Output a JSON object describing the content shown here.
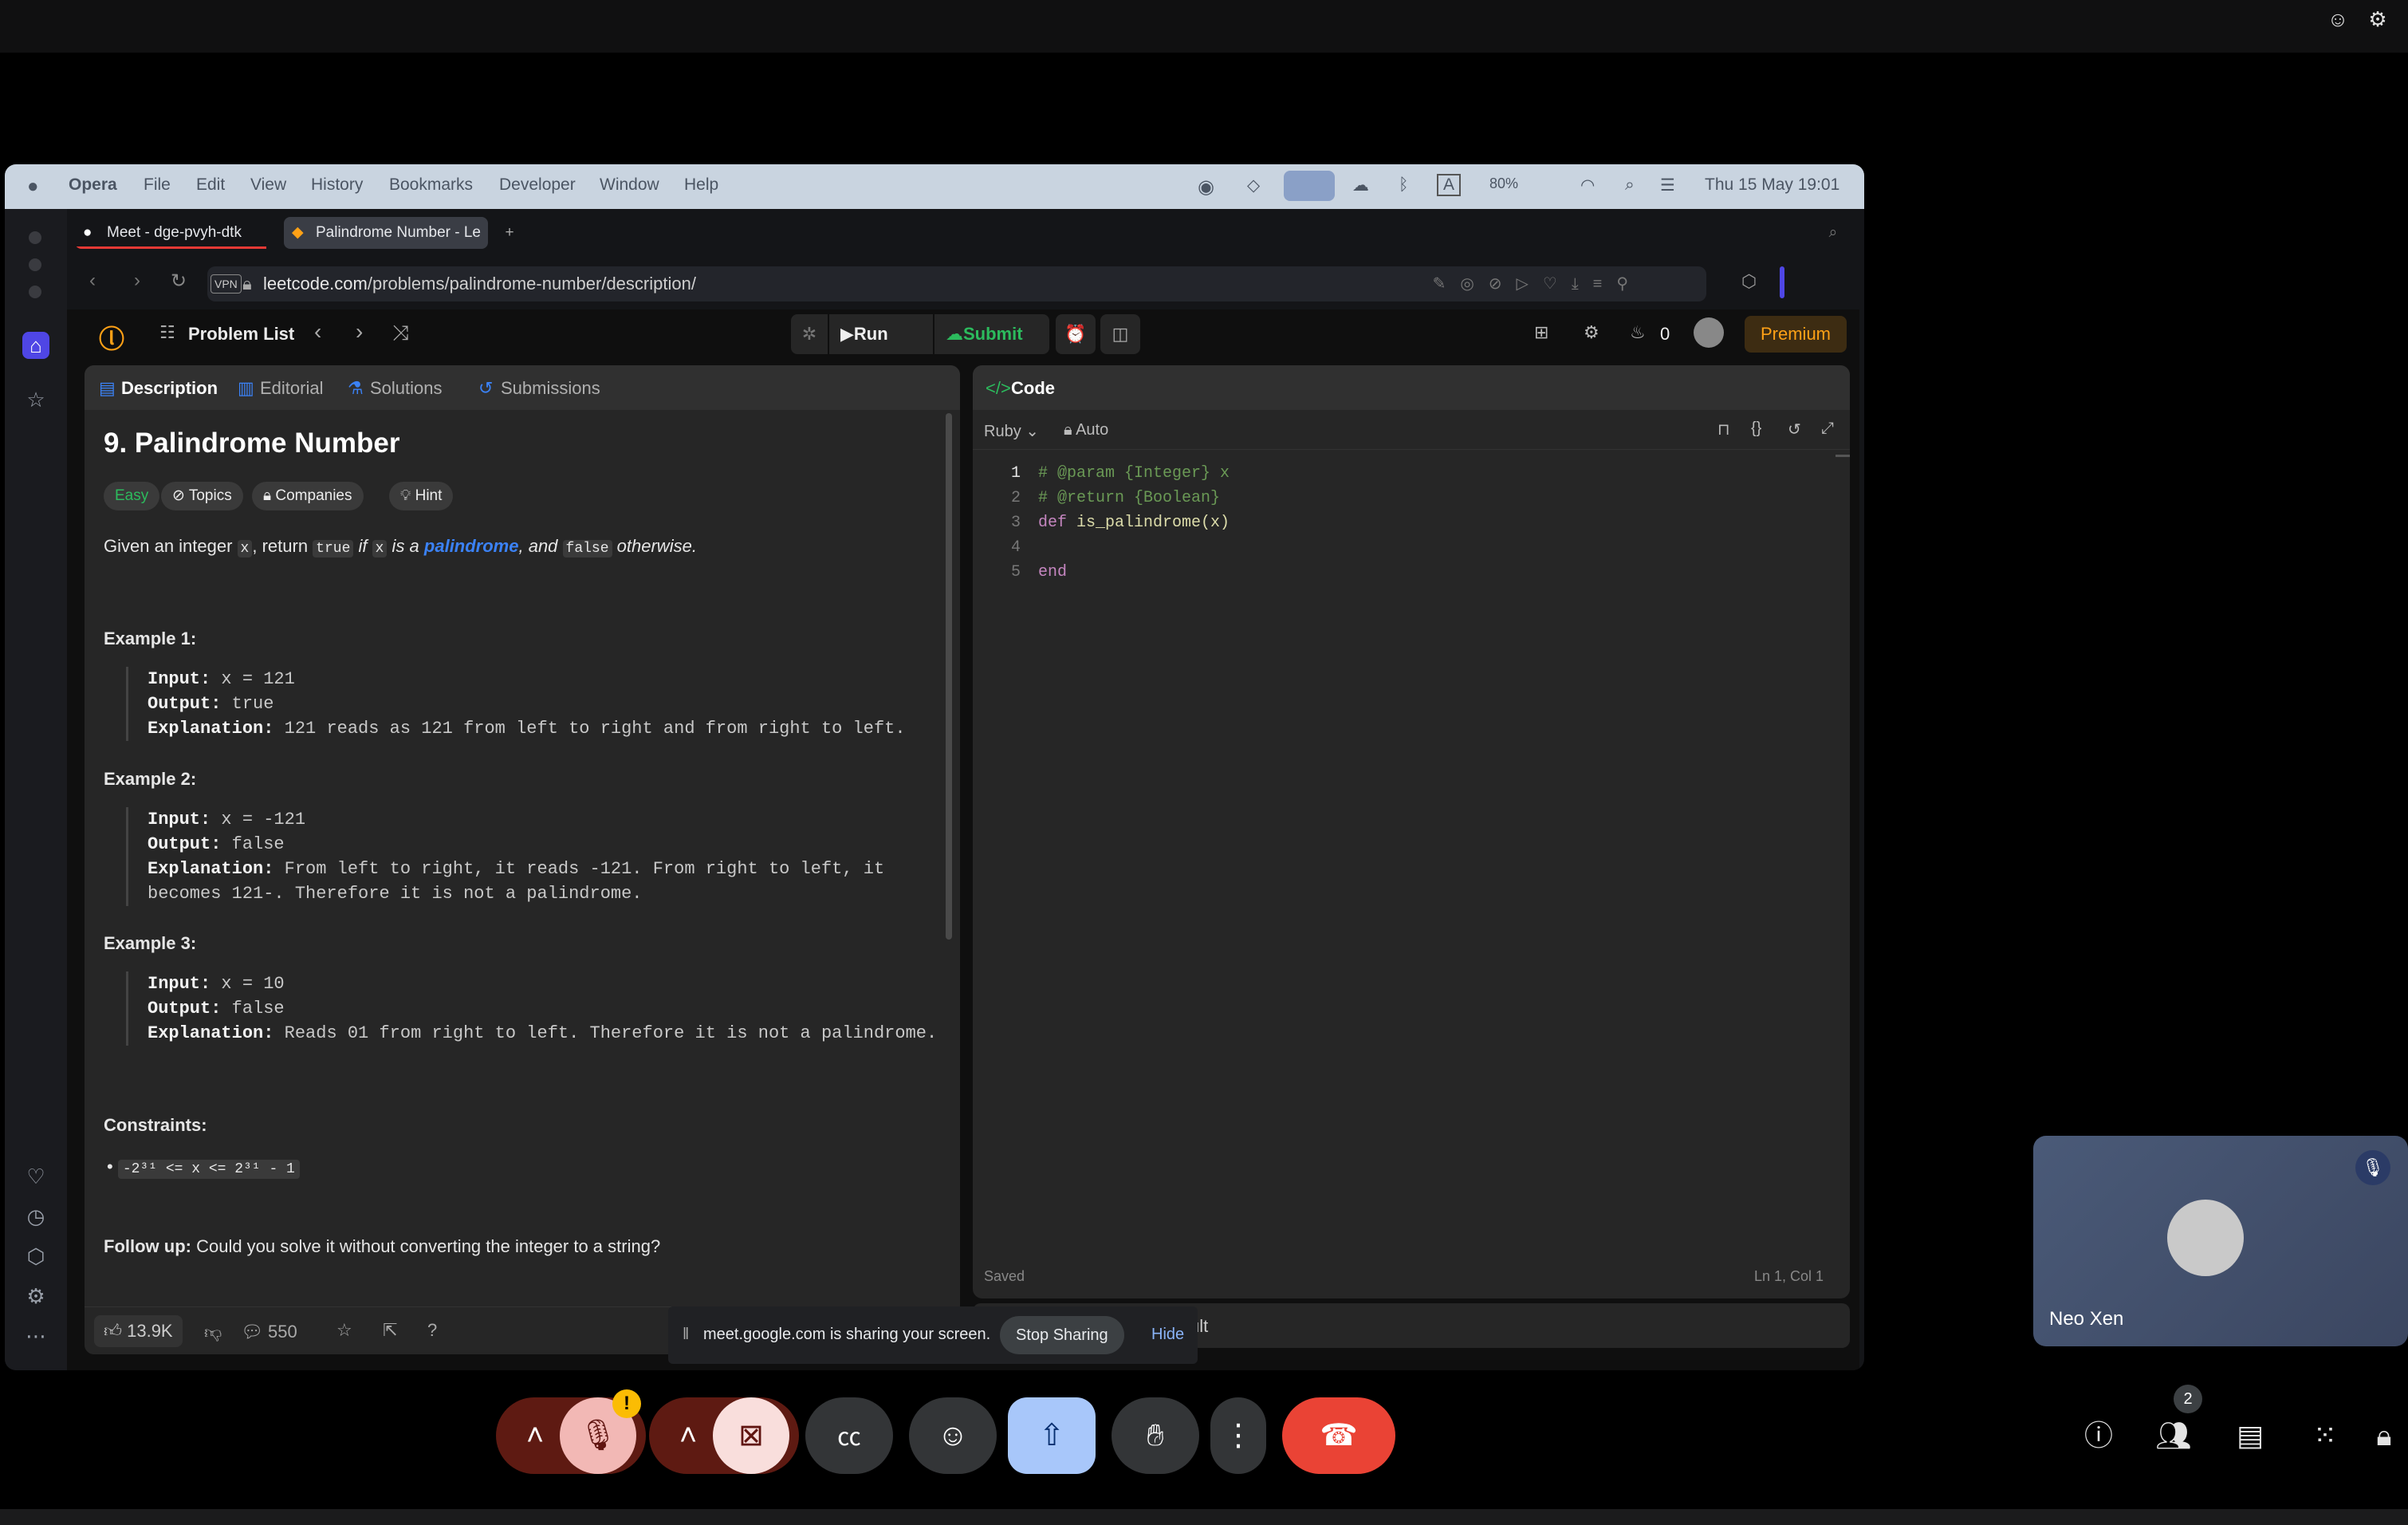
{
  "mac_menu": {
    "apple": "",
    "app": "Opera",
    "items": [
      "File",
      "Edit",
      "View",
      "History",
      "Bookmarks",
      "Developer",
      "Window",
      "Help"
    ],
    "battery": "80%",
    "datetime": "Thu 15 May  19:01"
  },
  "browser": {
    "tabs": [
      {
        "label": "Meet - dge-pvyh-dtk"
      },
      {
        "label": "Palindrome Number - Le"
      }
    ],
    "vpn": "VPN",
    "url_host": "leetcode.com",
    "url_path": "/problems/palindrome-number/description/"
  },
  "leetcode_top": {
    "problem_list": "Problem List",
    "run": "Run",
    "submit": "Submit",
    "streak": "0",
    "premium": "Premium"
  },
  "desc_tabs": [
    "Description",
    "Editorial",
    "Solutions",
    "Submissions"
  ],
  "problem": {
    "title": "9. Palindrome Number",
    "chips": [
      "Easy",
      "Topics",
      "Companies",
      "Hint"
    ],
    "statement": {
      "p1": "Given an integer ",
      "x": "x",
      ", return ": ", return ",
      "true": "true",
      "if": " if ",
      "x2": "x",
      " is a ": " is a ",
      "palindrome": "palindrome",
      ", and ": ", and ",
      "false": "false",
      "otherwise": " otherwise."
    },
    "examples": [
      {
        "heading": "Example 1:",
        "lines": [
          [
            "Input:",
            " x = 121"
          ],
          [
            "Output:",
            " true"
          ],
          [
            "Explanation:",
            " 121 reads as 121 from left to right and from right to left."
          ]
        ]
      },
      {
        "heading": "Example 2:",
        "lines": [
          [
            "Input:",
            " x = -121"
          ],
          [
            "Output:",
            " false"
          ],
          [
            "Explanation:",
            " From left to right, it reads -121. From right to left, it"
          ],
          [
            "",
            " becomes 121-. Therefore it is not a palindrome."
          ]
        ]
      },
      {
        "heading": "Example 3:",
        "lines": [
          [
            "Input:",
            " x = 10"
          ],
          [
            "Output:",
            " false"
          ],
          [
            "Explanation:",
            " Reads 01 from right to left. Therefore it is not a palindrome."
          ]
        ]
      }
    ],
    "constraints_heading": "Constraints:",
    "constraint": "-2³¹ <= x <= 2³¹ - 1",
    "followup_label": "Follow up:",
    "followup_text": " Could you solve it without converting the integer to a string?",
    "likes": "13.9K",
    "comments": "550"
  },
  "code_panel": {
    "title": "Code",
    "language": "Ruby",
    "auto": "Auto",
    "lines": [
      {
        "n": "1",
        "text": "# @param {Integer} x",
        "kind": "comment"
      },
      {
        "n": "2",
        "text": "# @return {Boolean}",
        "kind": "comment"
      },
      {
        "n": "3",
        "text": "is_palindrome(x)",
        "kw": "def ",
        "kind": "def"
      },
      {
        "n": "4",
        "text": "",
        "kind": "plain"
      },
      {
        "n": "5",
        "text": "end",
        "kind": "kw"
      }
    ],
    "status": "Saved",
    "cursor": "Ln 1, Col 1",
    "result_tab": "ult"
  },
  "share_banner": {
    "text": "meet.google.com is sharing your screen.",
    "stop": "Stop Sharing",
    "hide": "Hide"
  },
  "participant": {
    "name": "Neo Xen"
  },
  "meet_controls": {
    "people_count": "2",
    "warning": "!"
  },
  "colors": {
    "accent_orange": "#ffa116",
    "submit_green": "#2cbb5d",
    "link_blue": "#3b82f6",
    "end_call": "#ea4335",
    "present_blue": "#a8c7fa"
  }
}
